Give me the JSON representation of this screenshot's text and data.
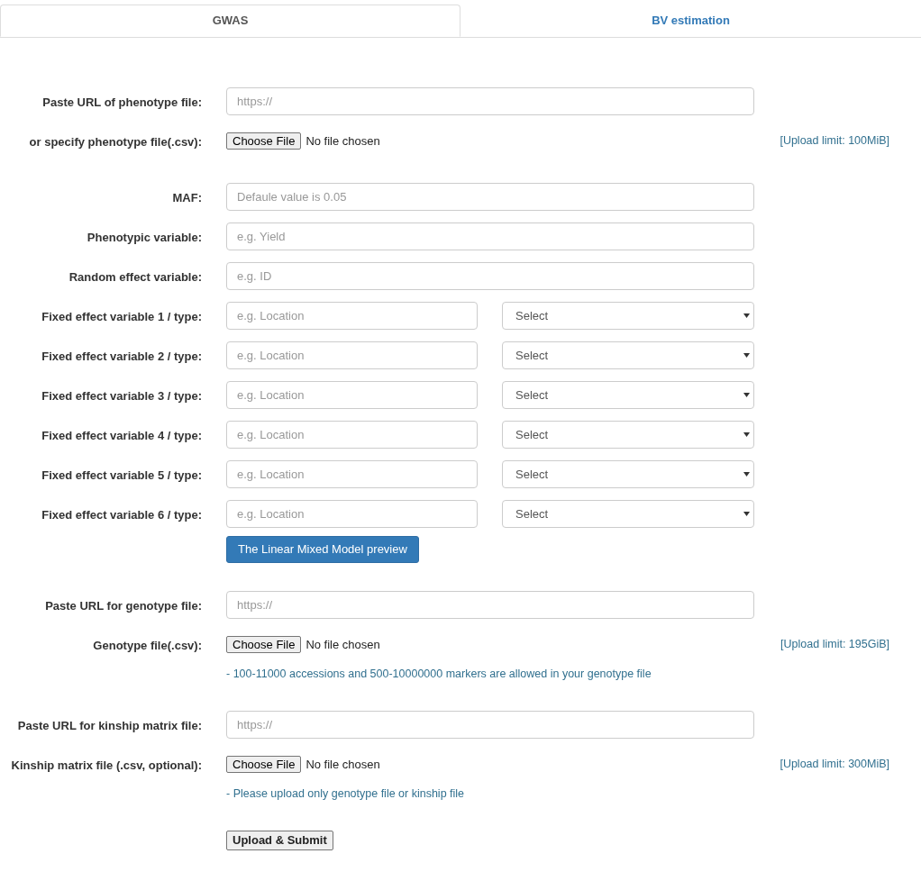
{
  "tabs": [
    {
      "label": "GWAS",
      "selected": true
    },
    {
      "label": "BV estimation",
      "selected": false
    }
  ],
  "sections": [
    {
      "rows": [
        {
          "kind": "url",
          "label": "Paste URL of phenotype file:",
          "placeholder": "https://"
        },
        {
          "kind": "file",
          "label": "or specify phenotype file(.csv):",
          "button": "Choose File",
          "status": "No file chosen",
          "limit": "[Upload limit: 100MiB]"
        }
      ]
    },
    {
      "rows": [
        {
          "kind": "text",
          "label": "MAF:",
          "placeholder": "Defaule value is 0.05"
        },
        {
          "kind": "text",
          "label": "Phenotypic variable:",
          "placeholder": "e.g. Yield"
        },
        {
          "kind": "text",
          "label": "Random effect variable:",
          "placeholder": "e.g. ID"
        },
        {
          "kind": "fixed",
          "label": "Fixed effect variable 1 / type:",
          "placeholder": "e.g. Location",
          "select": "Select"
        },
        {
          "kind": "fixed",
          "label": "Fixed effect variable 2 / type:",
          "placeholder": "e.g. Location",
          "select": "Select"
        },
        {
          "kind": "fixed",
          "label": "Fixed effect variable 3 / type:",
          "placeholder": "e.g. Location",
          "select": "Select"
        },
        {
          "kind": "fixed",
          "label": "Fixed effect variable 4 / type:",
          "placeholder": "e.g. Location",
          "select": "Select"
        },
        {
          "kind": "fixed",
          "label": "Fixed effect variable 5 / type:",
          "placeholder": "e.g. Location",
          "select": "Select"
        },
        {
          "kind": "fixed",
          "label": "Fixed effect variable 6 / type:",
          "placeholder": "e.g. Location",
          "select": "Select"
        },
        {
          "kind": "primary",
          "text": "The Linear Mixed Model preview"
        }
      ]
    },
    {
      "rows": [
        {
          "kind": "url",
          "label": "Paste URL for genotype file:",
          "placeholder": "https://"
        },
        {
          "kind": "file",
          "label": "Genotype file(.csv):",
          "button": "Choose File",
          "status": "No file chosen",
          "limit": "[Upload limit: 195GiB]"
        },
        {
          "kind": "note",
          "text": "- 100-11000 accessions and 500-10000000 markers are allowed in your genotype file"
        }
      ]
    },
    {
      "rows": [
        {
          "kind": "url",
          "label": "Paste URL for kinship matrix file:",
          "placeholder": "https://"
        },
        {
          "kind": "file",
          "label": "Kinship matrix file (.csv, optional):",
          "button": "Choose File",
          "status": "No file chosen",
          "limit": "[Upload limit: 300MiB]"
        },
        {
          "kind": "note",
          "text": "- Please upload only genotype file or kinship file"
        }
      ]
    },
    {
      "rows": [
        {
          "kind": "submit",
          "text": "Upload & Submit"
        }
      ]
    }
  ]
}
